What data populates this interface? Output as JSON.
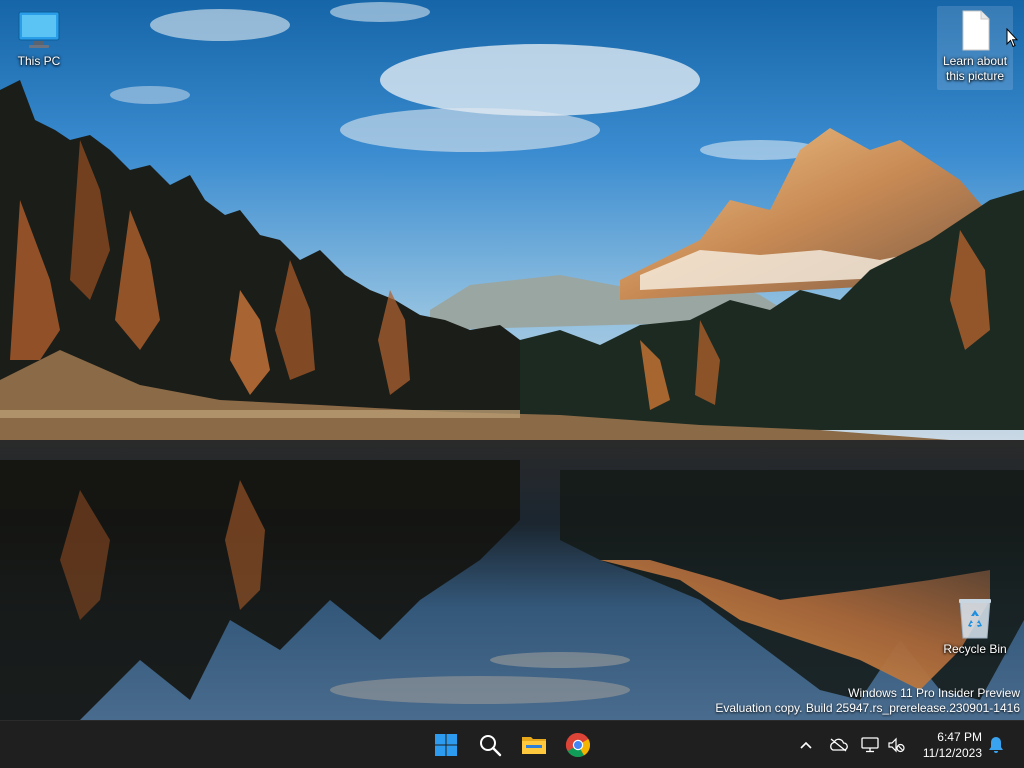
{
  "desktop": {
    "icons": [
      {
        "label": "This PC",
        "icon": "computer-monitor-icon"
      },
      {
        "label": "Learn about this picture",
        "icon": "document-icon"
      },
      {
        "label": "Recycle Bin",
        "icon": "recycle-bin-icon"
      }
    ],
    "watermark": {
      "line1": "Windows 11 Pro Insider Preview",
      "line2": "Evaluation copy. Build 25947.rs_prerelease.230901-1416"
    }
  },
  "taskbar": {
    "apps": [
      {
        "name": "Start",
        "icon": "windows-start-icon"
      },
      {
        "name": "Search",
        "icon": "search-icon"
      },
      {
        "name": "File Explorer",
        "icon": "folder-icon"
      },
      {
        "name": "Google Chrome",
        "icon": "chrome-icon"
      }
    ],
    "tray": {
      "icons": [
        "chevron-up-icon",
        "onedrive-cloud-icon",
        "display-network-icon",
        "volume-muted-icon",
        "notification-bell-icon"
      ],
      "time": "6:47 PM",
      "date": "11/12/2023"
    }
  },
  "colors": {
    "taskbar_bg": "#1f1f1f",
    "accent": "#2d9cf0"
  }
}
